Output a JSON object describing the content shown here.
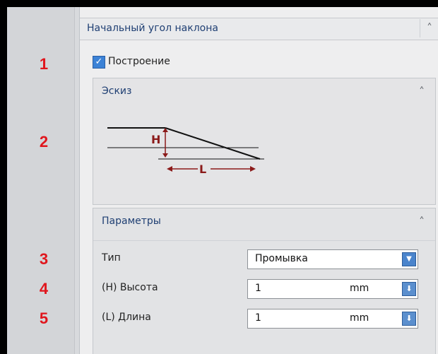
{
  "panel": {
    "title": "Начальный угол наклона",
    "collapse_icon": "chevron-up-icon"
  },
  "callouts": [
    "1",
    "2",
    "3",
    "4",
    "5"
  ],
  "build": {
    "label": "Построение",
    "checked": true
  },
  "sketch": {
    "title": "Эскиз",
    "labels": {
      "h": "H",
      "l": "L"
    }
  },
  "params": {
    "title": "Параметры",
    "type": {
      "label": "Тип",
      "value": "Промывка"
    },
    "height": {
      "label": "(H) Высота",
      "value": "1",
      "unit": "mm"
    },
    "length": {
      "label": "(L) Длина",
      "value": "1",
      "unit": "mm"
    }
  },
  "colors": {
    "accent": "#e0161d",
    "title_text": "#1f3f73",
    "dim_line": "#8b1a1a",
    "checkbox": "#3c82d6"
  }
}
